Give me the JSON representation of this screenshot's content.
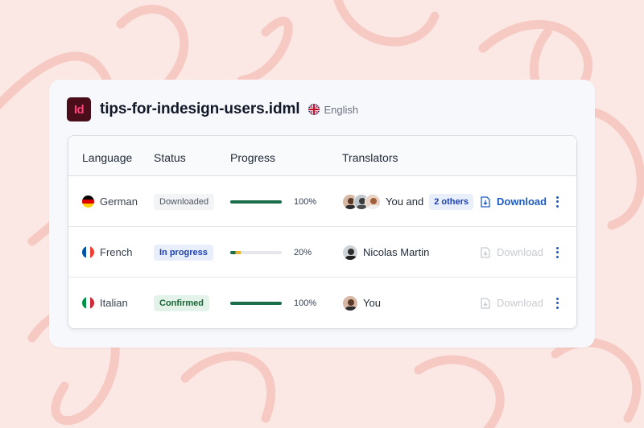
{
  "file": {
    "name": "tips-for-indesign-users.idml",
    "app_icon_text": "Id",
    "source_language": "English"
  },
  "table": {
    "headers": [
      "Language",
      "Status",
      "Progress",
      "Translators"
    ],
    "rows": [
      {
        "language": "German",
        "flag": "flag-germany-icon",
        "status": "Downloaded",
        "progress": 1.0,
        "progress_label": "100%",
        "translator": "You and",
        "others": "2 others",
        "download_label": "Download",
        "download_enabled": true
      },
      {
        "language": "French",
        "flag": "flag-france-icon",
        "status": "In progress",
        "progress": 0.2,
        "progress_label": "20%",
        "translator": "Nicolas Martin",
        "download_label": "Download",
        "download_enabled": false
      },
      {
        "language": "Italian",
        "flag": "flag-italy-icon",
        "status": "Confirmed",
        "progress": 1.0,
        "progress_label": "100%",
        "translator": "You",
        "download_label": "Download",
        "download_enabled": false
      }
    ]
  },
  "colors": {
    "accent": "#1e5bbf",
    "progress_complete": "#1b6e4a",
    "progress_partial": "#e8b32f",
    "background": "#fbe7e3"
  }
}
